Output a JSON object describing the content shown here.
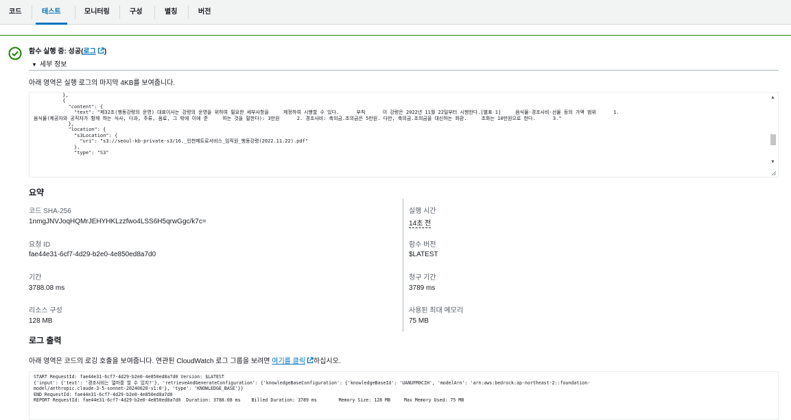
{
  "tabs": [
    {
      "label": "코드"
    },
    {
      "label": "테스트"
    },
    {
      "label": "모니터링"
    },
    {
      "label": "구성"
    },
    {
      "label": "별칭"
    },
    {
      "label": "버전"
    }
  ],
  "status": {
    "prefix": "함수 실행 중: 성공(",
    "log_link": "로그",
    "suffix": ")",
    "details_toggle": "세부 정보"
  },
  "log_tail_description": "아래 영역은 실행 로그의 마지막 4KB를 보여줍니다.",
  "execution_result_lines": [
    "          },",
    "          {",
    "            \"content\": {",
    "              \"text\": \"제32조(행동강령의 운영) 대표이사는 강령의 운영을 위하여 필요한 세부사항을     제정하여 시행할 수 있다.      부칙      이 강령은 2022년 11월 22일부터 시행한다.[별표 1]     음식물·경조사비·선물 등의 가액 범위      1.",
    "음식물(제공자와 공직자가 함께 하는 식사, 다과, 주류, 음료, 그 밖에 이에 준     하는 것을 말한다): 3만원      2. 경조사비: 축의금.조의금은 5만원. 다만, 축의금.조의금을 대신하는 화환.     조화는 10만원으로 한다.      3.\"",
    "            },",
    "            \"location\": {",
    "              \"s3Location\": {",
    "                \"uri\": \"s3://seoul-kb-private-s3/16._인천메트로서비스_임직원_행동강령(2022.11.22).pdf\"",
    "              },",
    "              \"type\": \"S3\""
  ],
  "summary": {
    "heading": "요약",
    "left": [
      {
        "label": "코드 SHA-256",
        "value": "1nmgJNVJoqHQMrJEHYHKLzzfwo4LSS6H5qrwGgc/k7c="
      },
      {
        "label": "요청 ID",
        "value": "fae44e31-6cf7-4d29-b2e0-4e850ed8a7d0"
      },
      {
        "label": "기간",
        "value": "3788.08 ms"
      },
      {
        "label": "리소스 구성",
        "value": "128 MB"
      }
    ],
    "right": [
      {
        "label": "실행 시간",
        "value": "14초 전"
      },
      {
        "label": "함수 버전",
        "value": "$LATEST"
      },
      {
        "label": "청구 기간",
        "value": "3789 ms"
      },
      {
        "label": "사용된 최대 메모리",
        "value": "75 MB"
      }
    ]
  },
  "log_output": {
    "heading": "로그 출력",
    "description_prefix": "아래 영역은 코드의 로깅 호출을 보여줍니다. 연관된 CloudWatch 로그 그룹을 보려면 ",
    "link_text": "여기를 클릭",
    "description_suffix": "하십시오.",
    "lines": [
      "START RequestId: fae44e31-6cf7-4d29-b2e0-4e850ed8a7d0 Version: $LATEST",
      "{'input': {'text': '경조사비는 얼마를 할 수 있지?'}, 'retrieveAndGenerateConfiguration': {'knowledgeBaseConfiguration': {'knowledgeBaseId': 'UANUFM0CIH', 'modelArn': 'arn:aws:bedrock:ap-northeast-2::foundation-",
      "model/anthropic.claude-3-5-sonnet-20240620-v1:0'}, 'type': 'KNOWLEDGE_BASE'}}",
      "END RequestId: fae44e31-6cf7-4d29-b2e0-4e850ed8a7d0",
      "REPORT RequestId: fae44e31-6cf7-4d29-b2e0-4e850ed8a7d0  Duration: 3788.08 ms    Billed Duration: 3789 ms        Memory Size: 128 MB     Max Memory Used: 75 MB"
    ]
  },
  "colors": {
    "accent": "#0073bb",
    "success": "#1d8102",
    "tab_bar_bg": "#f2f3f3"
  },
  "icons": [
    "check-circle-icon",
    "external-link-icon",
    "caret-down-icon",
    "scroll-up-icon",
    "scroll-down-icon",
    "resize-handle-icon"
  ]
}
